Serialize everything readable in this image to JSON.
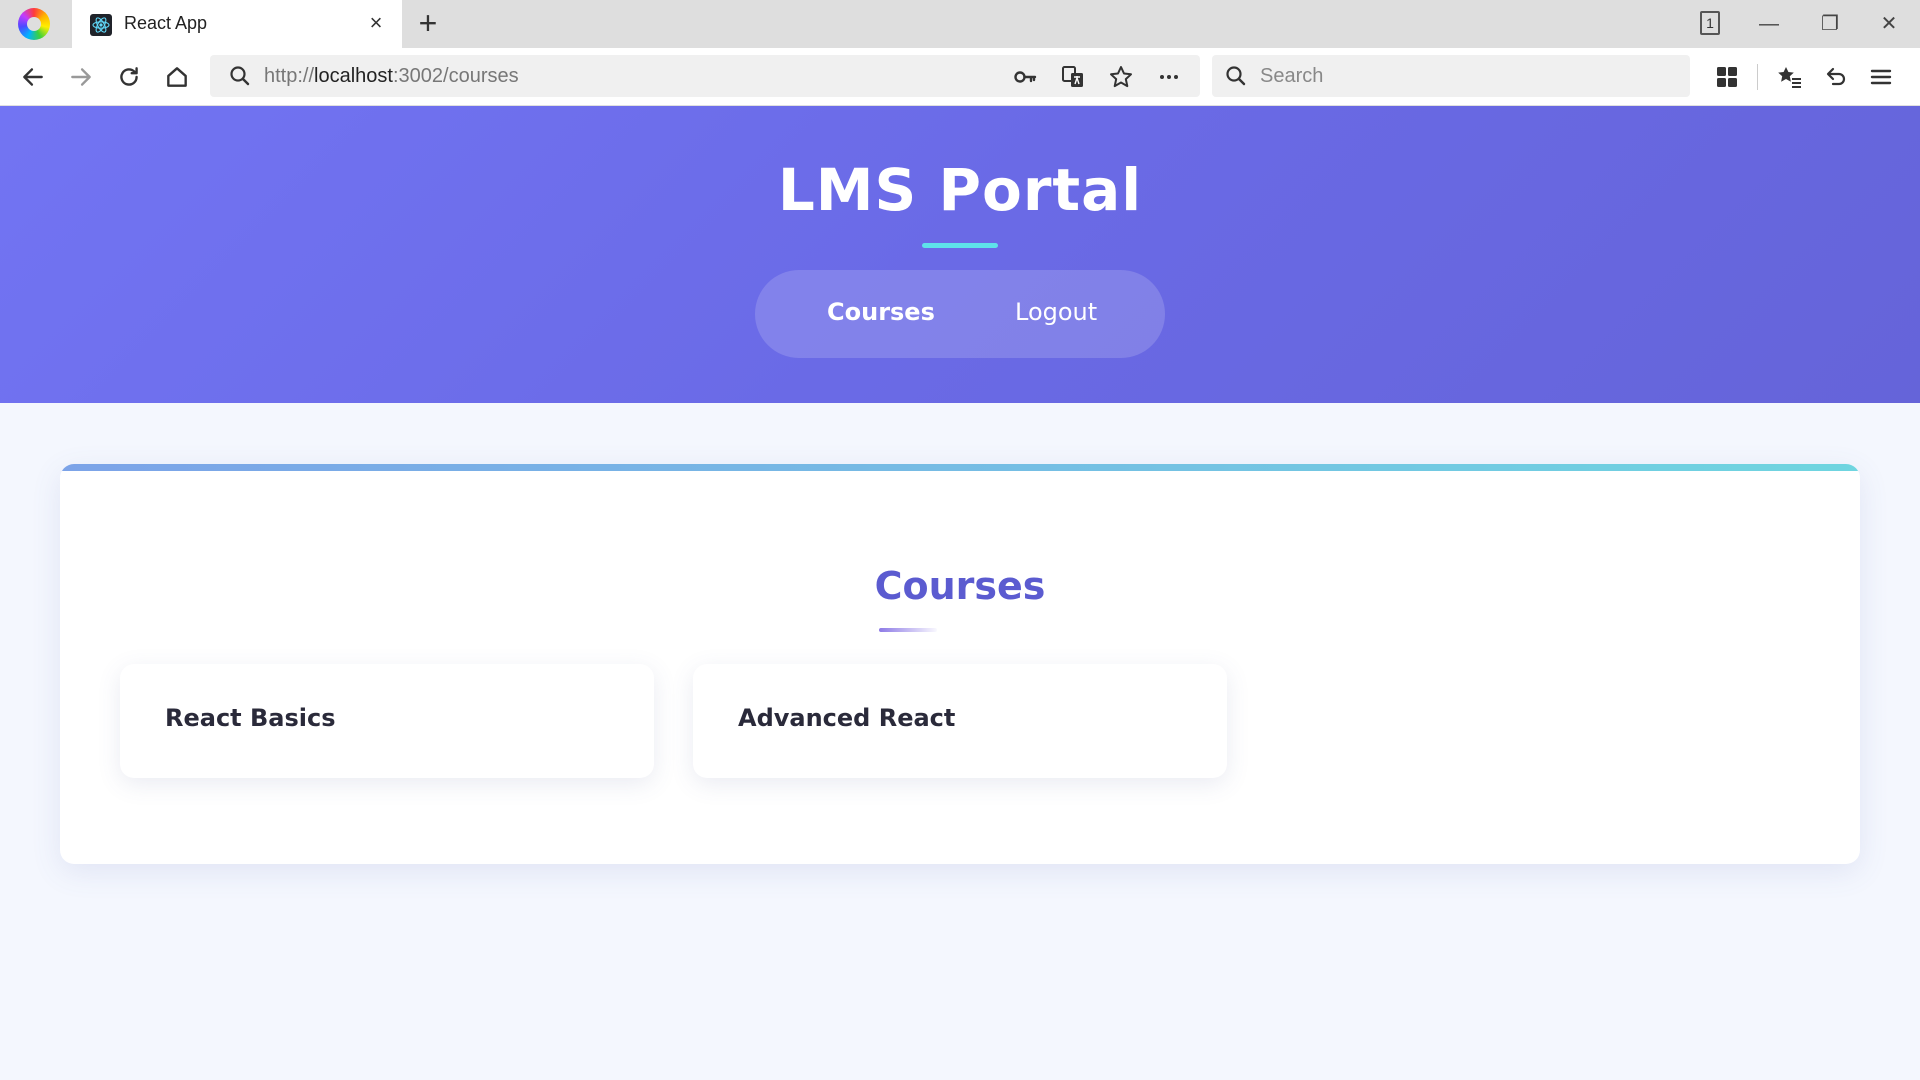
{
  "browser": {
    "tab_title": "React App",
    "tab_close": "×",
    "new_tab": "+",
    "tab_count": "1",
    "url": {
      "scheme": "http://",
      "host": "localhost",
      "rest": ":3002/courses"
    },
    "search_placeholder": "Search",
    "window_controls": {
      "minimize": "—",
      "restore": "❐",
      "close": "✕"
    }
  },
  "header": {
    "title": "LMS Portal",
    "nav": [
      {
        "label": "Courses"
      },
      {
        "label": "Logout"
      }
    ]
  },
  "main": {
    "section_title": "Courses",
    "courses": [
      {
        "title": "React Basics"
      },
      {
        "title": "Advanced React"
      }
    ]
  },
  "colors": {
    "header_gradient_start": "#7274f3",
    "header_gradient_end": "#6564d9",
    "title_underline": "#5ee3ea",
    "section_title": "#5b5bd0",
    "card_accent_start": "#7ca3e8",
    "card_accent_end": "#6fd5e0",
    "page_background": "#f4f7fe"
  }
}
